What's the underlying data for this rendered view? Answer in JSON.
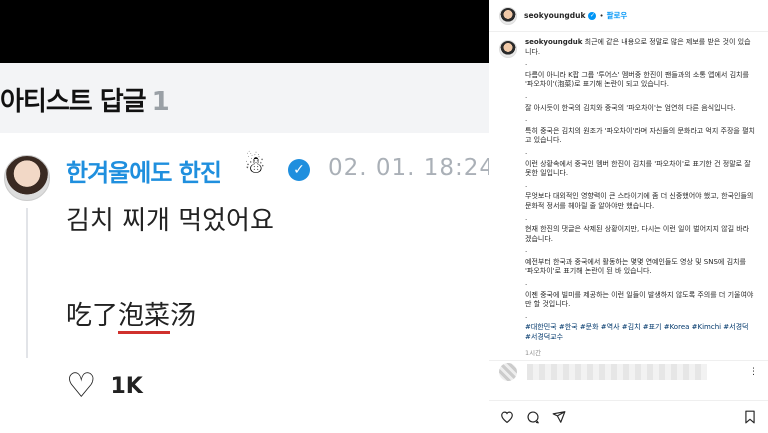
{
  "media": {
    "card_title": "아티스트 답글",
    "card_title_num": "1",
    "username": "한겨울에도 한진",
    "snowman": "☃",
    "time": "02. 01. 18:24",
    "korean_text": "김치 찌개 먹었어요",
    "chinese_prefix": "吃了",
    "chinese_highlight": "泡菜",
    "chinese_suffix": "汤",
    "like_count": "1K"
  },
  "post": {
    "username": "seokyoungduk",
    "follow_label": "팔로우",
    "caption_user": "seokyoungduk",
    "paragraphs": [
      "최근에 같은 내용으로 정말로 많은 제보를 받은 것이 있습니다.",
      ".",
      "다름이 아니라 K팝 그룹 '투어스' 멤버중 한진이 팬들과의 소통 앱에서 김치를 '파오차이'(泡菜)로 표기해 논란이 되고 있습니다.",
      ".",
      "잘 아시듯이 한국의 김치와 중국의 '파오차이'는 엄연히 다른 음식입니다.",
      ".",
      "특히 중국은 김치의 원조가 '파오차이'라며 자신들의 문화라고 억지 주장을 펼치고 있습니다.",
      ".",
      "이런 상황속에서 중국인 멤버 한진이 김치를 '파오차이'로 표기한 건 정말로 잘못한 일입니다.",
      ".",
      "무엇보다 대외적인 영향력이 큰 스타이기에 좀 더 신중했어야 했고, 한국인들의 문화적 정서를 헤아릴 줄 알아야만 했습니다.",
      ".",
      "현재 한진의 댓글은 삭제된 상황이지만, 다시는 이런 일이 벌어지지 않길 바라겠습니다.",
      ".",
      "예전부터 한국과 중국에서 활동하는 몇몇 연예인들도 영상 및 SNS에 김치를 '파오차이'로 표기해 논란이 된 바 있습니다.",
      ".",
      "이젠 중국에 빌미를 제공하는 이런 일들이 발생하지 않도록 주의를 더 기울여야만 할 것입니다.",
      "."
    ],
    "hashtags": "#대한민국 #한국 #문화 #역사 #김치 #표기 #Korea #Kimchi #서경덕 #서경덕교수",
    "time_ago": "1시간",
    "more_icon_text": "⋮"
  },
  "icons": {
    "verified": "verified-badge-icon",
    "heart": "heart-icon",
    "comment": "comment-icon",
    "share": "share-icon",
    "bookmark": "bookmark-icon"
  }
}
